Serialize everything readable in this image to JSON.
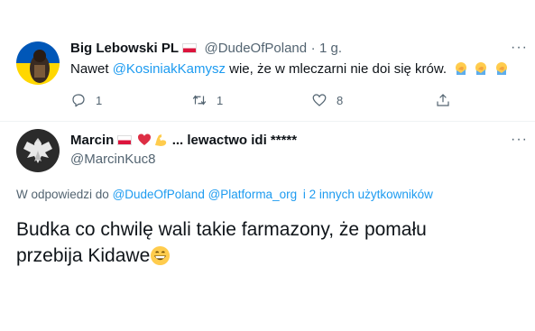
{
  "tweet1": {
    "display_name": "Big Lebowski PL",
    "handle": "@DudeOfPoland",
    "separator": "·",
    "time": "1 g.",
    "text_prefix": "Nawet ",
    "mention": "@KosiniakKamysz",
    "text_suffix": " wie, że w mleczarni nie doi się krów.",
    "reply_count": "1",
    "retweet_count": "1",
    "like_count": "8"
  },
  "tweet2": {
    "display_name": "Marcin",
    "name_suffix": "... lewactwo idi *****",
    "handle": "@MarcinKuc8",
    "reply_to_prefix": "W odpowiedzi do ",
    "reply_to_user1": "@DudeOfPoland",
    "reply_to_user2": "@Platforma_org",
    "reply_to_others": "i 2 innych użytkowników",
    "body_text": "Budka co chwilę wali takie farmazony, że pomału przebija Kidawe"
  },
  "colors": {
    "accent": "#1d9bf0",
    "muted": "#536471",
    "divider": "#eff3f4"
  },
  "icons": [
    "flag-poland-icon",
    "more-icon",
    "reply-icon",
    "retweet-icon",
    "like-icon",
    "share-icon",
    "red-heart-icon",
    "flexed-bicep-icon",
    "facepalm-emoji-icon",
    "grinning-emoji-icon",
    "eagle-avatar-icon"
  ]
}
